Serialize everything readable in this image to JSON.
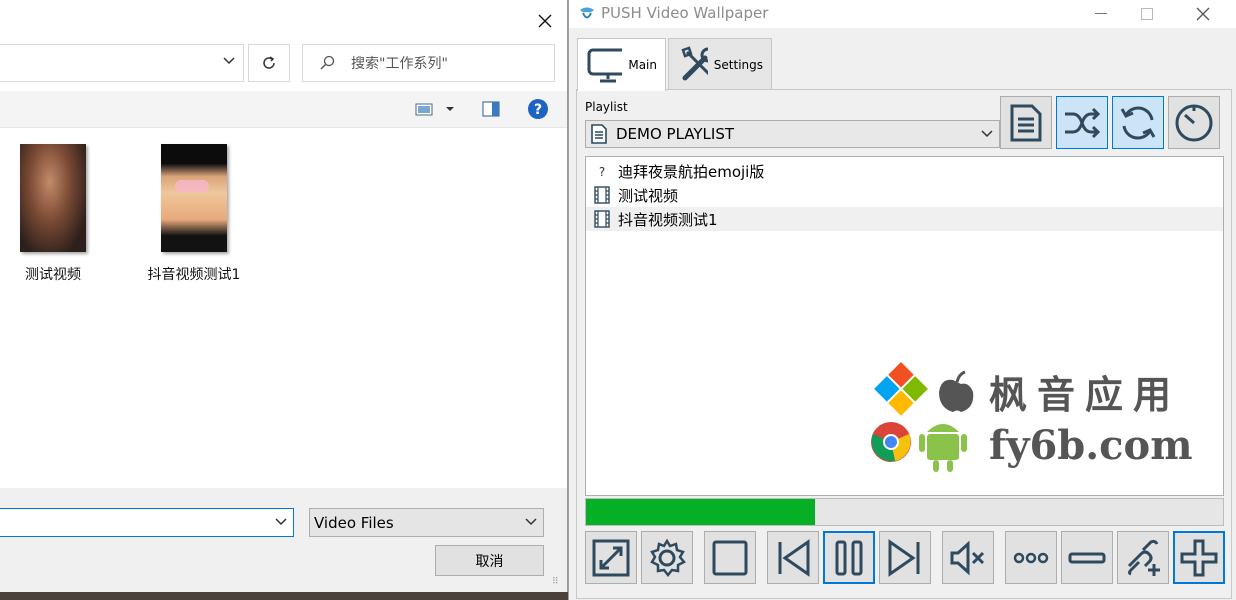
{
  "file_dialog": {
    "search_placeholder": "搜索\"工作系列\"",
    "files": [
      {
        "name": "测试视频"
      },
      {
        "name": "抖音视频测试1"
      }
    ],
    "file_type": "Video Files",
    "cancel_label": "取消"
  },
  "app": {
    "title": "PUSH Video Wallpaper",
    "tabs": [
      {
        "label": "Main",
        "icon": "monitor-icon",
        "active": true
      },
      {
        "label": "Settings",
        "icon": "tools-icon",
        "active": false
      }
    ],
    "playlist_label": "Playlist",
    "playlist_value": "DEMO PLAYLIST",
    "playlist_items": [
      {
        "name": "迪拜夜景航拍emoji版",
        "icon": "question-icon"
      },
      {
        "name": "测试视频",
        "icon": "film-icon"
      },
      {
        "name": "抖音视频测试1",
        "icon": "film-icon"
      }
    ],
    "selected_index": 2,
    "progress": 0.36,
    "watermark": {
      "line1": "枫音应用",
      "line2": "fy6b.com"
    },
    "colors": {
      "accent": "#0078d7",
      "toggle_bg": "#cce4f7",
      "progress": "#06b025",
      "icon_stroke": "#2f4a5e"
    }
  }
}
